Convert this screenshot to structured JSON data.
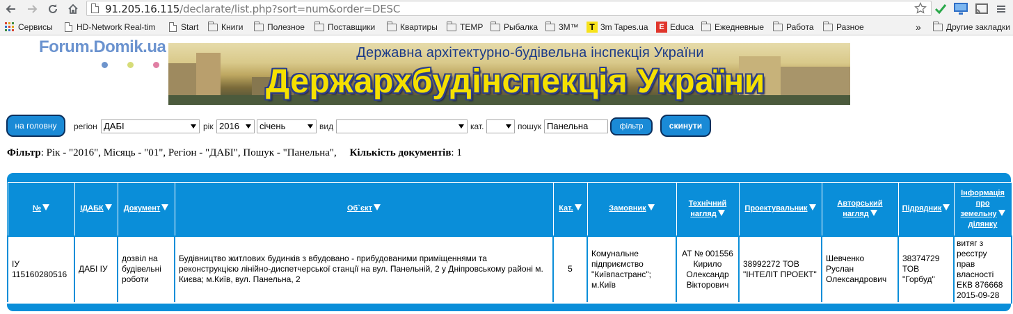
{
  "browser": {
    "url_host": "91.205.16.115",
    "url_path": "/declarate/list.php?sort=num&order=DESC",
    "bookmarks": [
      {
        "label": "Сервисы",
        "icon": "apps-grid-icon"
      },
      {
        "label": "HD-Network Real-tim",
        "icon": "page-icon"
      },
      {
        "label": "Start",
        "icon": "page-icon"
      },
      {
        "label": "Книги",
        "icon": "folder-icon"
      },
      {
        "label": "Полезное",
        "icon": "folder-icon"
      },
      {
        "label": "Поставщики",
        "icon": "folder-icon"
      },
      {
        "label": "Квартиры",
        "icon": "folder-icon"
      },
      {
        "label": "TEMP",
        "icon": "folder-icon"
      },
      {
        "label": "Рыбалка",
        "icon": "folder-icon"
      },
      {
        "label": "3M™",
        "icon": "folder-icon"
      },
      {
        "label": "3m Tapes.ua",
        "icon": "t-logo-icon"
      },
      {
        "label": "Educa",
        "icon": "e-logo-icon"
      },
      {
        "label": "Ежедневные",
        "icon": "folder-icon"
      },
      {
        "label": "Работа",
        "icon": "folder-icon"
      },
      {
        "label": "Разное",
        "icon": "folder-icon"
      }
    ],
    "overflow_label": "»",
    "other_bookmarks": "Другие закладки"
  },
  "header": {
    "logo_text": "Forum.Domik.ua",
    "banner_subtitle": "Державна архітектурно-будівельна інспекція України",
    "banner_title": "Держархбудінспекція України"
  },
  "filters": {
    "home_button": "на головну",
    "region_label": "регіон",
    "region_value": "ДАБІ",
    "year_label": "рік",
    "year_value": "2016",
    "month_value": "січень",
    "type_label": "вид",
    "type_value": "",
    "cat_label": "кат.",
    "cat_value": "",
    "search_label": "пошук",
    "search_value": "Панельна",
    "filter_button": "фільтр",
    "reset_button": "скинути"
  },
  "summary": {
    "filter_title": "Фільтр",
    "filter_text": ": Рік - \"2016\", Місяць - \"01\", Регіон - \"ДАБІ\", Пошук - \"Панельна\",     ",
    "count_title": "Кількість документів",
    "count_text": ": 1"
  },
  "table": {
    "headers": {
      "num": "№",
      "idabk": "ІДАБК",
      "doc": "Документ",
      "object": "Об`єкт",
      "cat": "Кат.",
      "customer": "Замовник",
      "tech_1": "Технічний",
      "tech_2": "нагляд",
      "designer": "Проектувальник",
      "author_1": "Авторський",
      "author_2": "нагляд",
      "contractor": "Підрядник",
      "land_1": "Інформація",
      "land_2": "про",
      "land_3": "земельну",
      "land_4": "ділянку"
    },
    "row": {
      "num_1": "ІУ",
      "num_2": "115160280516",
      "idabk": "ДАБІ ІУ",
      "doc_1": "дозвіл на",
      "doc_2": "будівельні",
      "doc_3": "роботи",
      "object_1": "Будівництво житлових будинків з вбудовано - прибудованими приміщеннями та",
      "object_2": "реконструкцією лінійно-диспетчерської станції на вул. Панельній, 2 у Дніпровському районі м.",
      "object_3": "Києва; м.Київ, вул. Панельна, 2",
      "cat": "5",
      "customer_1": "Комунальне",
      "customer_2": "підприємство",
      "customer_3": "\"Київпастранс\";",
      "customer_4": "м.Київ",
      "tech_1": "АТ № 001556",
      "tech_2": "Кирило",
      "tech_3": "Олександр",
      "tech_4": "Вікторович",
      "designer_1": "38992272 ТОВ",
      "designer_2": "\"ІНТЕЛІТ ПРОЕКТ\"",
      "author_1": "Шевченко",
      "author_2": "Руслан",
      "author_3": "Олександрович",
      "contractor_1": "38374729",
      "contractor_2": "ТОВ",
      "contractor_3": "\"Горбуд\"",
      "land_1": "витяг з",
      "land_2": "реєстру",
      "land_3": "прав",
      "land_4": "власності",
      "land_5": "ЕКВ 876668",
      "land_6": "2015-09-28"
    }
  },
  "colors": {
    "accent": "#0a8ed9",
    "button_border": "#0b2f5c",
    "banner_title": "#f5e000",
    "banner_subtitle": "#1b3a88",
    "logo": "#6b93cf"
  }
}
